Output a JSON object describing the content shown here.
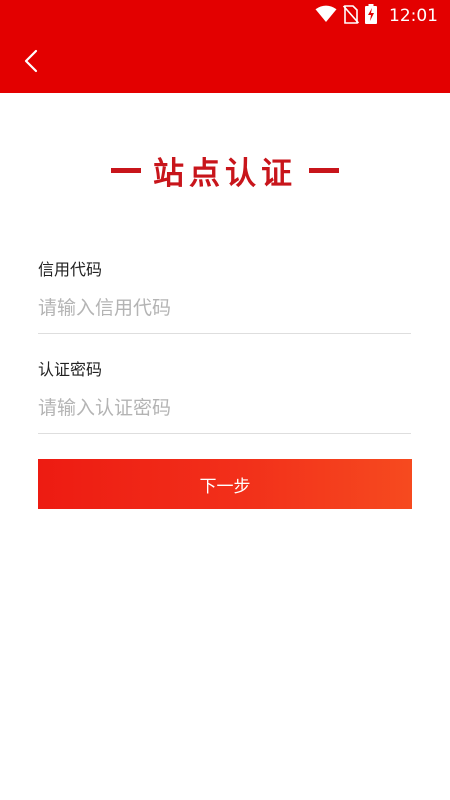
{
  "status_bar": {
    "time": "12:01",
    "icons": [
      "wifi-icon",
      "no-sim-icon",
      "battery-charging-icon"
    ]
  },
  "app_bar": {
    "back_icon": "chevron-left-icon"
  },
  "page": {
    "title": "站点认证"
  },
  "form": {
    "credit_code": {
      "label": "信用代码",
      "placeholder": "请输入信用代码",
      "value": ""
    },
    "auth_password": {
      "label": "认证密码",
      "placeholder": "请输入认证密码",
      "value": ""
    },
    "next_button_label": "下一步"
  },
  "colors": {
    "primary_red": "#e30000",
    "title_red": "#c8151b",
    "button_gradient_start": "#ed1b12",
    "button_gradient_end": "#f64a1f",
    "placeholder_gray": "#b4b4b4",
    "divider_gray": "#dedede"
  }
}
